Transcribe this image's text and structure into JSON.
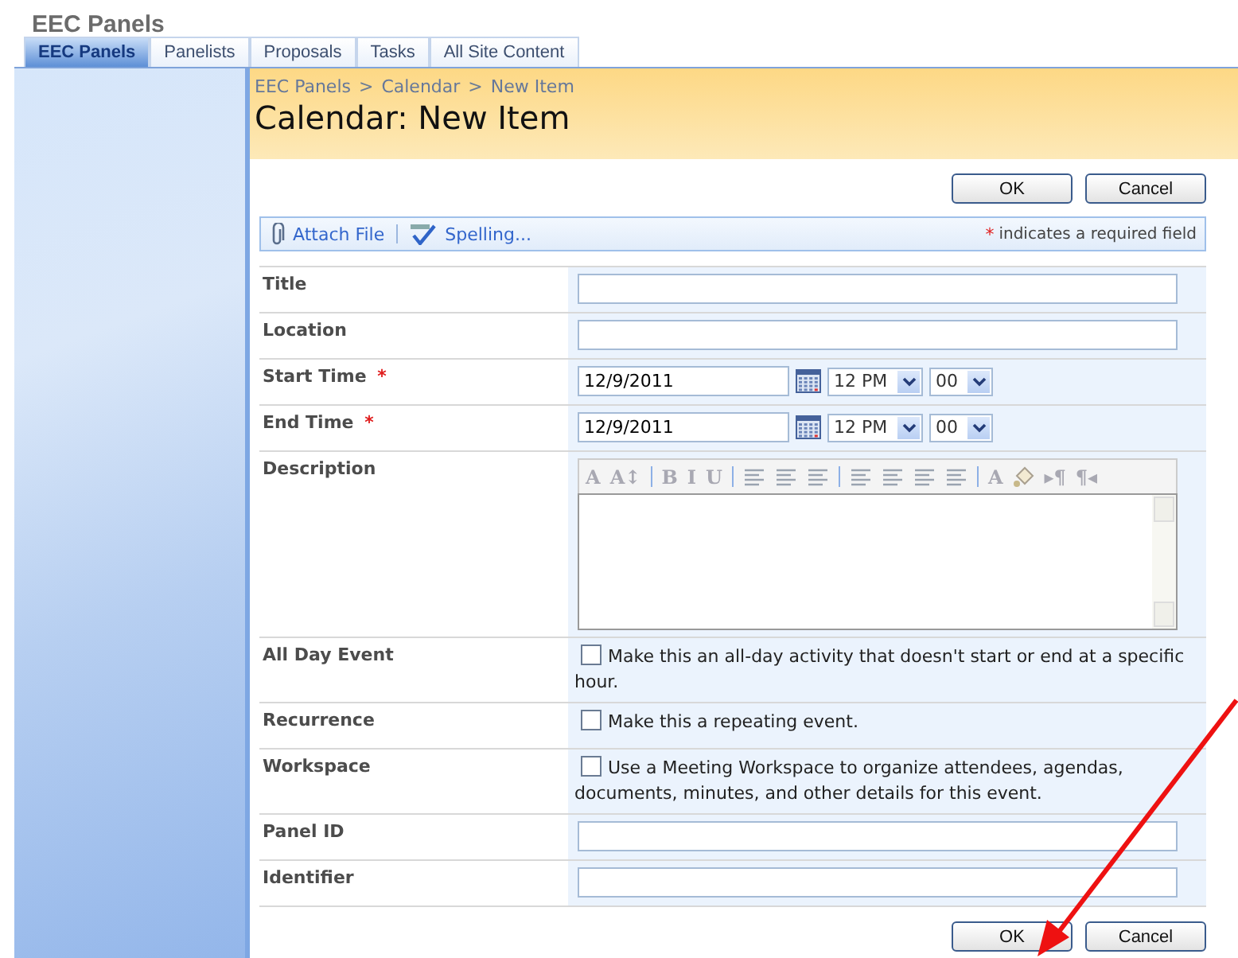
{
  "site_title": "EEC Panels",
  "tabs": [
    {
      "label": "EEC Panels",
      "selected": true
    },
    {
      "label": "Panelists",
      "selected": false
    },
    {
      "label": "Proposals",
      "selected": false
    },
    {
      "label": "Tasks",
      "selected": false
    },
    {
      "label": "All Site Content",
      "selected": false
    }
  ],
  "breadcrumb": [
    {
      "label": "EEC Panels"
    },
    {
      "label": "Calendar"
    },
    {
      "label": "New Item"
    }
  ],
  "breadcrumb_separator": ">",
  "page_title": "Calendar: New Item",
  "top_buttons": [
    "OK",
    "Cancel"
  ],
  "bottom_buttons": [
    "OK",
    "Cancel"
  ],
  "toolbar": {
    "attach": "Attach File",
    "spelling": "Spelling...",
    "required_mark": "*",
    "required_note": "indicates a required field"
  },
  "fields": [
    {
      "kind": "text",
      "label": "Title",
      "required": false
    },
    {
      "kind": "text",
      "label": "Location",
      "required": false
    },
    {
      "kind": "datetime",
      "label": "Start Time",
      "required": true,
      "date": "12/9/2011",
      "hour": "12 PM",
      "minute": "00"
    },
    {
      "kind": "datetime",
      "label": "End Time",
      "required": true,
      "date": "12/9/2011",
      "hour": "12 PM",
      "minute": "00"
    },
    {
      "kind": "richtext",
      "label": "Description",
      "required": false
    },
    {
      "kind": "checkbox",
      "label": "All Day Event",
      "required": false,
      "checked": false,
      "text": "Make this an all-day activity that doesn't start or end at a specific hour."
    },
    {
      "kind": "checkbox",
      "label": "Recurrence",
      "required": false,
      "checked": false,
      "text": "Make this a repeating event."
    },
    {
      "kind": "checkbox",
      "label": "Workspace",
      "required": false,
      "checked": false,
      "text": "Use a Meeting Workspace to organize attendees, agendas, documents, minutes, and other details for this event."
    },
    {
      "kind": "text",
      "label": "Panel ID",
      "required": false
    },
    {
      "kind": "text",
      "label": "Identifier",
      "required": false
    }
  ],
  "editor_toolbar": [
    {
      "kind": "glyph",
      "label": "A"
    },
    {
      "kind": "glyph",
      "label": "A↕"
    },
    {
      "kind": "sep"
    },
    {
      "kind": "glyph",
      "label": "B"
    },
    {
      "kind": "glyph",
      "label": "I"
    },
    {
      "kind": "glyph",
      "label": "U"
    },
    {
      "kind": "sep"
    },
    {
      "kind": "lines"
    },
    {
      "kind": "lines"
    },
    {
      "kind": "lines"
    },
    {
      "kind": "sep"
    },
    {
      "kind": "lines"
    },
    {
      "kind": "lines"
    },
    {
      "kind": "lines"
    },
    {
      "kind": "lines"
    },
    {
      "kind": "sep"
    },
    {
      "kind": "glyph",
      "label": "A"
    },
    {
      "kind": "fill"
    },
    {
      "kind": "glyph",
      "label": "▸¶"
    },
    {
      "kind": "glyph",
      "label": "¶◂"
    }
  ]
}
